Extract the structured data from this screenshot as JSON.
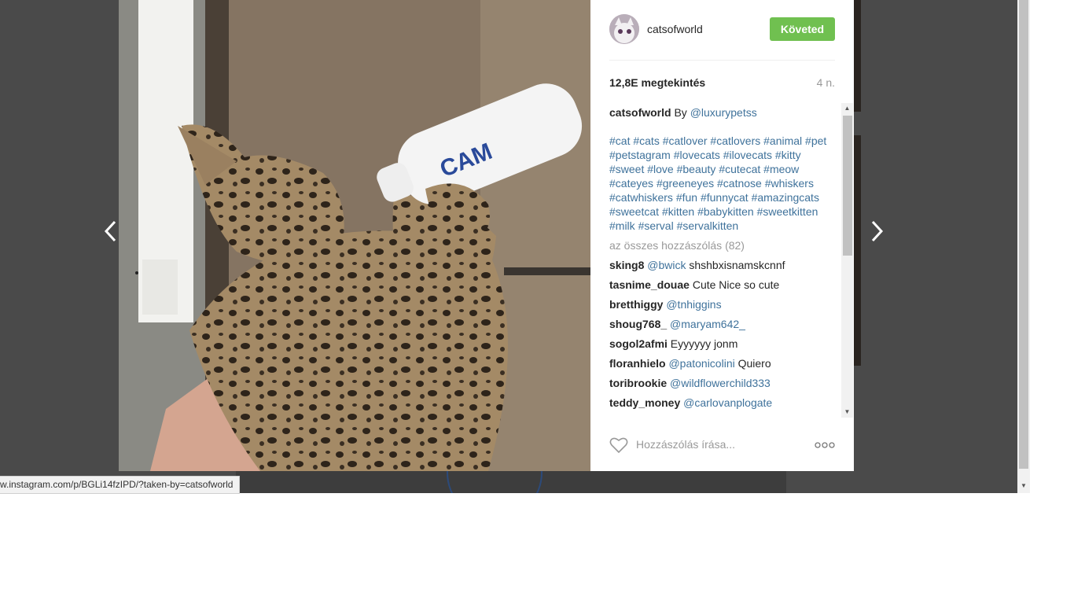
{
  "post": {
    "username": "catsofworld",
    "follow_label": "Követed",
    "views": "12,8E megtekintés",
    "age": "4 n.",
    "caption": {
      "user": "catsofworld",
      "text": " By ",
      "mention": "@luxurypetss"
    },
    "hashtags": [
      "#cat",
      "#cats",
      "#catlover",
      "#catlovers",
      "#animal",
      "#pet",
      "#petstagram",
      "#lovecats",
      "#ilovecats",
      "#kitty",
      "#sweet",
      "#love",
      "#beauty",
      "#cutecat",
      "#meow",
      "#cateyes",
      "#greeneyes",
      "#catnose",
      "#whiskers",
      "#catwhiskers",
      "#fun",
      "#funnycat",
      "#amazingcats",
      "#sweetcat",
      "#kitten",
      "#babykitten",
      "#sweetkitten",
      "#milk",
      "#serval",
      "#servalkitten"
    ],
    "all_comments_label": "az összes hozzászólás (82)",
    "comments": [
      {
        "user": "sking8",
        "mention": "@bwick",
        "text": " shshbxisnamskcnnf"
      },
      {
        "user": "tasnime_douae",
        "mention": "",
        "text": " Cute Nice so cute"
      },
      {
        "user": "bretthiggy",
        "mention": "@tnhiggins",
        "text": ""
      },
      {
        "user": "shoug768_",
        "mention": "@maryam642_",
        "text": ""
      },
      {
        "user": "sogol2afmi",
        "mention": "",
        "text": " Eyyyyyy jonm"
      },
      {
        "user": "floranhielo",
        "mention": "@patonicolini",
        "text": " Quiero"
      },
      {
        "user": "toribrookie",
        "mention": "@wildflowerchild333",
        "text": ""
      },
      {
        "user": "teddy_money",
        "mention": "@carlovanplogate",
        "text": ""
      }
    ],
    "comment_placeholder": "Hozzászólás írása..."
  },
  "icons": {
    "prev": "chevron-left-icon",
    "next": "chevron-right-icon",
    "like": "heart-outline-icon",
    "more": "more-options-icon"
  },
  "status_bar": {
    "url": "w.instagram.com/p/BGLi14fzIPD/?taken-by=catsofworld"
  },
  "colors": {
    "follow": "#70c050",
    "link": "#3f729b",
    "overlay": "#4a4a4a"
  }
}
